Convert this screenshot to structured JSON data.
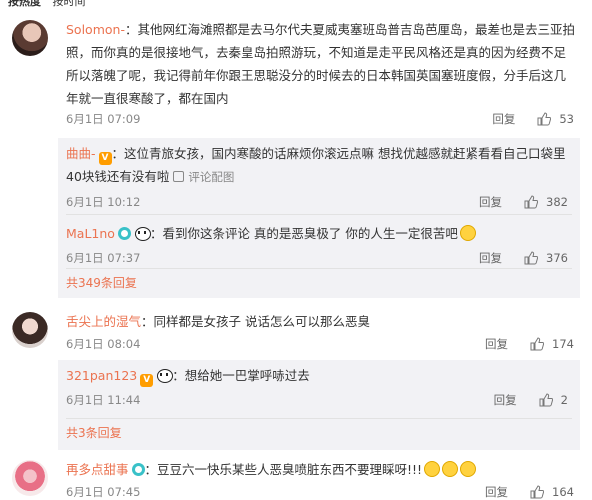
{
  "sort": {
    "hot": "按热度",
    "time": "按时间"
  },
  "comments": [
    {
      "username": "Solomon-",
      "text": "：其他网红海滩照都是去马尔代夫夏威夷塞班岛普吉岛芭厘岛，最差也是去三亚拍照，而你真的是很接地气，去秦皇岛拍照游玩，不知道是走平民风格还是真的因为经费不足所以落魄了呢，我记得前年你跟王思聪没分的时候去的日本韩国英国塞班度假，分手后这几年就一直很寒酸了，都在国内",
      "time": "6月1日 07:09",
      "reply": "回复",
      "likes": "53",
      "replies": [
        {
          "username": "曲曲-",
          "text": "：这位青旅女孩，国内寒酸的话麻烦你滚远点嘛 想找优越感就赶紧看看自己口袋里40块钱还有没有啦",
          "image_link": "评论配图",
          "time": "6月1日 10:12",
          "reply": "回复",
          "likes": "382"
        },
        {
          "username": "MaL1no",
          "text": "：看到你这条评论 真的是恶臭极了 你的人生一定很苦吧",
          "time": "6月1日 07:37",
          "reply": "回复",
          "likes": "376"
        }
      ],
      "more": "共349条回复"
    },
    {
      "username": "舌尖上的湿气",
      "text": "：同样都是女孩子 说话怎么可以那么恶臭",
      "time": "6月1日 08:04",
      "reply": "回复",
      "likes": "174",
      "replies": [
        {
          "username": "321pan123",
          "text": "：想给她一巴掌呼哧过去",
          "time": "6月1日 11:44",
          "reply": "回复",
          "likes": "2"
        }
      ],
      "more": "共3条回复"
    },
    {
      "username": "再多点甜事",
      "text": "：豆豆六一快乐某些人恶臭喷脏东西不要理睬呀!!!",
      "time": "6月1日 07:45",
      "reply": "回复",
      "likes": "164"
    }
  ],
  "colors": {
    "accent": "#eb7350",
    "subbg": "#f2f2f5"
  }
}
